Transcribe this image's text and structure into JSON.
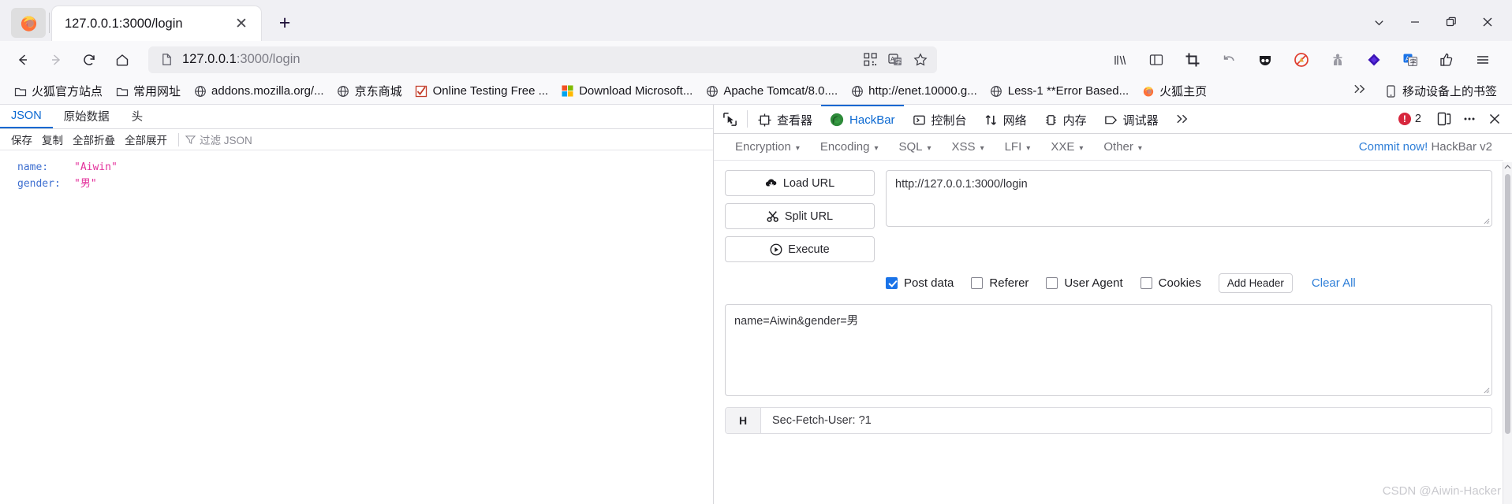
{
  "browser": {
    "tab": {
      "title": "127.0.0.1:3000/login",
      "close_icon": "close-icon"
    },
    "new_tab_label": "+",
    "tab_list_icon": "chevron-down-icon",
    "window_buttons": {
      "minimize": "–",
      "maximize": "❐",
      "close": "✕"
    },
    "nav": {
      "back_icon": "back-arrow-icon",
      "forward_icon": "forward-arrow-icon",
      "reload_icon": "reload-icon",
      "home_icon": "home-icon"
    },
    "urlbar": {
      "page_icon": "page-document-icon",
      "host": "127.0.0.1",
      "path": ":3000/login",
      "qr_icon": "qrcode-icon",
      "translate_icon": "translate-icon",
      "bookmark_icon": "star-icon"
    },
    "toolbar_icons": [
      "library-icon",
      "sidebar-icon",
      "screenshot-crop-icon",
      "undo-icon",
      "pocket-icon",
      "adblock-icon",
      "spy-user-icon",
      "violentmonkey-icon",
      "translate-page-icon",
      "thumbs-up-icon",
      "hamburger-menu-icon"
    ],
    "bookmarks": [
      {
        "label": "火狐官方站点",
        "icon": "folder-icon"
      },
      {
        "label": "常用网址",
        "icon": "folder-icon"
      },
      {
        "label": "addons.mozilla.org/...",
        "icon": "globe-icon"
      },
      {
        "label": "京东商城",
        "icon": "globe-icon"
      },
      {
        "label": "Online Testing Free ...",
        "icon": "checkmark-box-icon"
      },
      {
        "label": "Download Microsoft...",
        "icon": "microsoft-icon"
      },
      {
        "label": "Apache Tomcat/8.0....",
        "icon": "globe-icon"
      },
      {
        "label": "http://enet.10000.g...",
        "icon": "globe-icon"
      },
      {
        "label": "Less-1 **Error Based...",
        "icon": "globe-icon"
      },
      {
        "label": "火狐主页",
        "icon": "firefox-icon"
      }
    ],
    "bookmarks_overflow_icon": "chevron-double-right-icon",
    "mobile_bookmarks": {
      "label": "移动设备上的书签",
      "icon": "mobile-icon"
    }
  },
  "json_viewer": {
    "tabs": [
      {
        "label": "JSON",
        "active": true
      },
      {
        "label": "原始数据",
        "active": false
      },
      {
        "label": "头",
        "active": false
      }
    ],
    "toolbar": {
      "save": "保存",
      "copy": "复制",
      "collapse_all": "全部折叠",
      "expand_all": "全部展开",
      "filter_icon": "filter-icon",
      "filter_placeholder": "过滤 JSON"
    },
    "rows": [
      {
        "key": "name:",
        "value": "\"Aiwin\""
      },
      {
        "key": "gender:",
        "value": "\"男\""
      }
    ]
  },
  "devtools": {
    "picker_icon": "element-picker-icon",
    "tabs": [
      {
        "label": "查看器",
        "icon": "inspector-icon",
        "active": false
      },
      {
        "label": "HackBar",
        "icon": "hackbar-fox-icon",
        "active": true
      },
      {
        "label": "控制台",
        "icon": "console-icon",
        "active": false
      },
      {
        "label": "网络",
        "icon": "network-arrows-icon",
        "active": false
      },
      {
        "label": "内存",
        "icon": "memory-icon",
        "active": false
      },
      {
        "label": "调试器",
        "icon": "debugger-icon",
        "active": false
      }
    ],
    "overflow_icon": "chevron-double-right-icon",
    "error_count": "2",
    "error_icon": "error-circle-icon",
    "dock_icon": "dock-layout-icon",
    "meatball_icon": "more-options-icon",
    "close_icon": "close-icon"
  },
  "hackbar": {
    "menu": [
      {
        "label": "Encryption"
      },
      {
        "label": "Encoding"
      },
      {
        "label": "SQL"
      },
      {
        "label": "XSS"
      },
      {
        "label": "LFI"
      },
      {
        "label": "XXE"
      },
      {
        "label": "Other"
      }
    ],
    "caret": "▾",
    "commit": {
      "link": "Commit now!",
      "version": "HackBar v2"
    },
    "buttons": [
      {
        "label": "Load URL",
        "icon": "cloud-download-icon"
      },
      {
        "label": "Split URL",
        "icon": "scissors-icon"
      },
      {
        "label": "Execute",
        "icon": "play-circle-icon"
      }
    ],
    "url_value": "http://127.0.0.1:3000/login",
    "options": [
      {
        "label": "Post data",
        "checked": true
      },
      {
        "label": "Referer",
        "checked": false
      },
      {
        "label": "User Agent",
        "checked": false
      },
      {
        "label": "Cookies",
        "checked": false
      }
    ],
    "add_header_label": "Add Header",
    "clear_all_label": "Clear All",
    "post_data_value": "name=Aiwin&gender=男",
    "headers": [
      {
        "type": "H",
        "value": "Sec-Fetch-User: ?1"
      }
    ]
  },
  "watermark": "CSDN @Aiwin-Hacker"
}
